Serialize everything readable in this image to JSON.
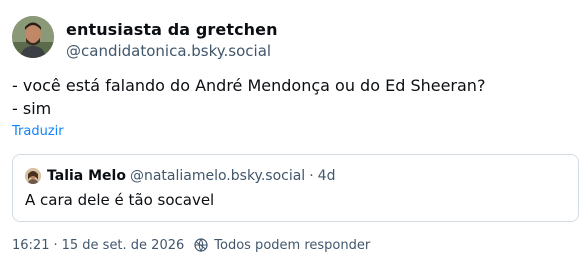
{
  "author": {
    "display_name": "entusiasta da gretchen",
    "handle": "@candidatonica.bsky.social",
    "avatar_icon": "avatar-photo"
  },
  "post": {
    "lines": [
      "- você está falando do André Mendonça ou do Ed Sheeran?",
      "- sim"
    ],
    "translate_label": "Traduzir"
  },
  "quote": {
    "display_name": "Talia Melo",
    "handle": "@nataliamelo.bsky.social",
    "separator": "·",
    "age": "4d",
    "text": "A cara dele é tão socavel",
    "avatar_icon": "avatar-photo"
  },
  "meta": {
    "time": "16:21",
    "separator": "·",
    "date": "15 de set. de 2026",
    "reply_icon": "globe-reply-icon",
    "reply_setting": "Todos podem responder"
  },
  "colors": {
    "text": "#0b0f14",
    "muted": "#42576c",
    "link": "#1083fe",
    "border": "#d4dbe2"
  }
}
